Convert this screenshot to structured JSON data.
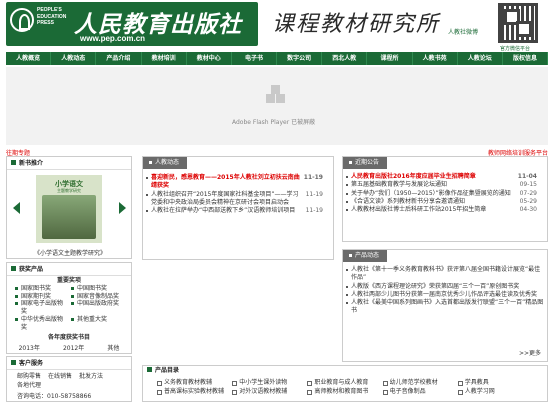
{
  "header": {
    "logo_en": [
      "PEOPLE'S",
      "EDUCATION",
      "PRESS"
    ],
    "logo_cn": "人民教育出版社",
    "url": "www.pep.com.cn",
    "site_title": "课程教材研究所",
    "weibo": "人教社微博",
    "qr_caption": "官方微信平台"
  },
  "nav": [
    "人教概览",
    "人教动态",
    "产品介绍",
    "教材培训",
    "教材中心",
    "电子书",
    "数字公司",
    "西北人教",
    "课程所",
    "人教书苑",
    "人教论坛",
    "版权信息"
  ],
  "flash": {
    "message": "Adobe Flash Player 已被屏蔽"
  },
  "links": {
    "left": "往期专题",
    "right": "教师网络培训服务平台"
  },
  "new_books": {
    "title": "新书推介",
    "cover_title": "小学语文",
    "cover_sub": "主题教学研究",
    "caption": "《小学语文主题教学研究》"
  },
  "news": {
    "title": "人教动态",
    "items": [
      {
        "text": "喜迎新民，感恩教育——2015年人教社刘立初扶云南曲靖获奖",
        "date": "11-19",
        "highlight": true
      },
      {
        "text": "人教社组织召开“2015年度国家社科基金项目”——学习党委和中央政治局委员会精神在京研讨会项目启动会",
        "date": "11-19",
        "highlight": false
      },
      {
        "text": "人教社在拉萨举办“中西部送教下乡”汉语教师培训项目",
        "date": "11-19",
        "highlight": false
      }
    ]
  },
  "notices": {
    "title": "近期公告",
    "items": [
      {
        "text": "人民教育出版社2016年度应届毕业生招聘简章",
        "date": "11-04",
        "highlight": true
      },
      {
        "text": "第五届基础教育教学与发展论坛通知",
        "date": "09-15",
        "highlight": false
      },
      {
        "text": "关于举办“我们（1950—2015）”影像作品征集暨展览的通知",
        "date": "07-29",
        "highlight": false
      },
      {
        "text": "《合语文读》系列教材新书分享会邀请通知",
        "date": "05-29",
        "highlight": false
      },
      {
        "text": "人教教材出版社博士后科研工作站2015年招生简章",
        "date": "04-30",
        "highlight": false
      }
    ]
  },
  "products_news": {
    "title": "产品动态",
    "items": [
      {
        "text": "人教社《第十一季义务教育教科书》获评第八届全国书籍设计展览“最佳作品”"
      },
      {
        "text": "人教版《西方课程理论研究》荣获第四届“三个一百”原创图书奖"
      },
      {
        "text": "人教社两部少儿图书分获第一届南京优秀少儿作品评选最佳读及优秀奖"
      },
      {
        "text": "人教社《最美中国系列图画书》入选首都出版发行联盟“三个一百”精品图书"
      }
    ],
    "more": ">>更多"
  },
  "awards": {
    "title": "获奖产品",
    "subtitle": "重要奖项",
    "items": [
      "国家图书奖",
      "中国图书奖",
      "国家期刊奖",
      "国家音像制品奖",
      "国家电子出版物奖",
      "中国出版政府奖",
      "中华优秀出版物奖",
      "其他重大奖"
    ],
    "year_title": "各年度获奖书目",
    "years": [
      "2013年",
      "2012年",
      "其他"
    ]
  },
  "service": {
    "title": "客户服务",
    "items": [
      "邮购零售",
      "在线销售",
      "批发方法",
      "各地代理"
    ],
    "phone": "咨询电话：010-58758866"
  },
  "catalog": {
    "title": "产品目录",
    "items": [
      "义务教育教材教辅",
      "中小学生课外读物",
      "职业教育与成人教育",
      "幼儿师范学校教材",
      "学具教具",
      "普高课标实验教材教辅",
      "对外汉语教材教辅",
      "高师教材和教育图书",
      "电子音像制品",
      "人教学习网"
    ]
  },
  "colors": {
    "brand": "#1b6a36",
    "accent_red": "#dd0000"
  }
}
